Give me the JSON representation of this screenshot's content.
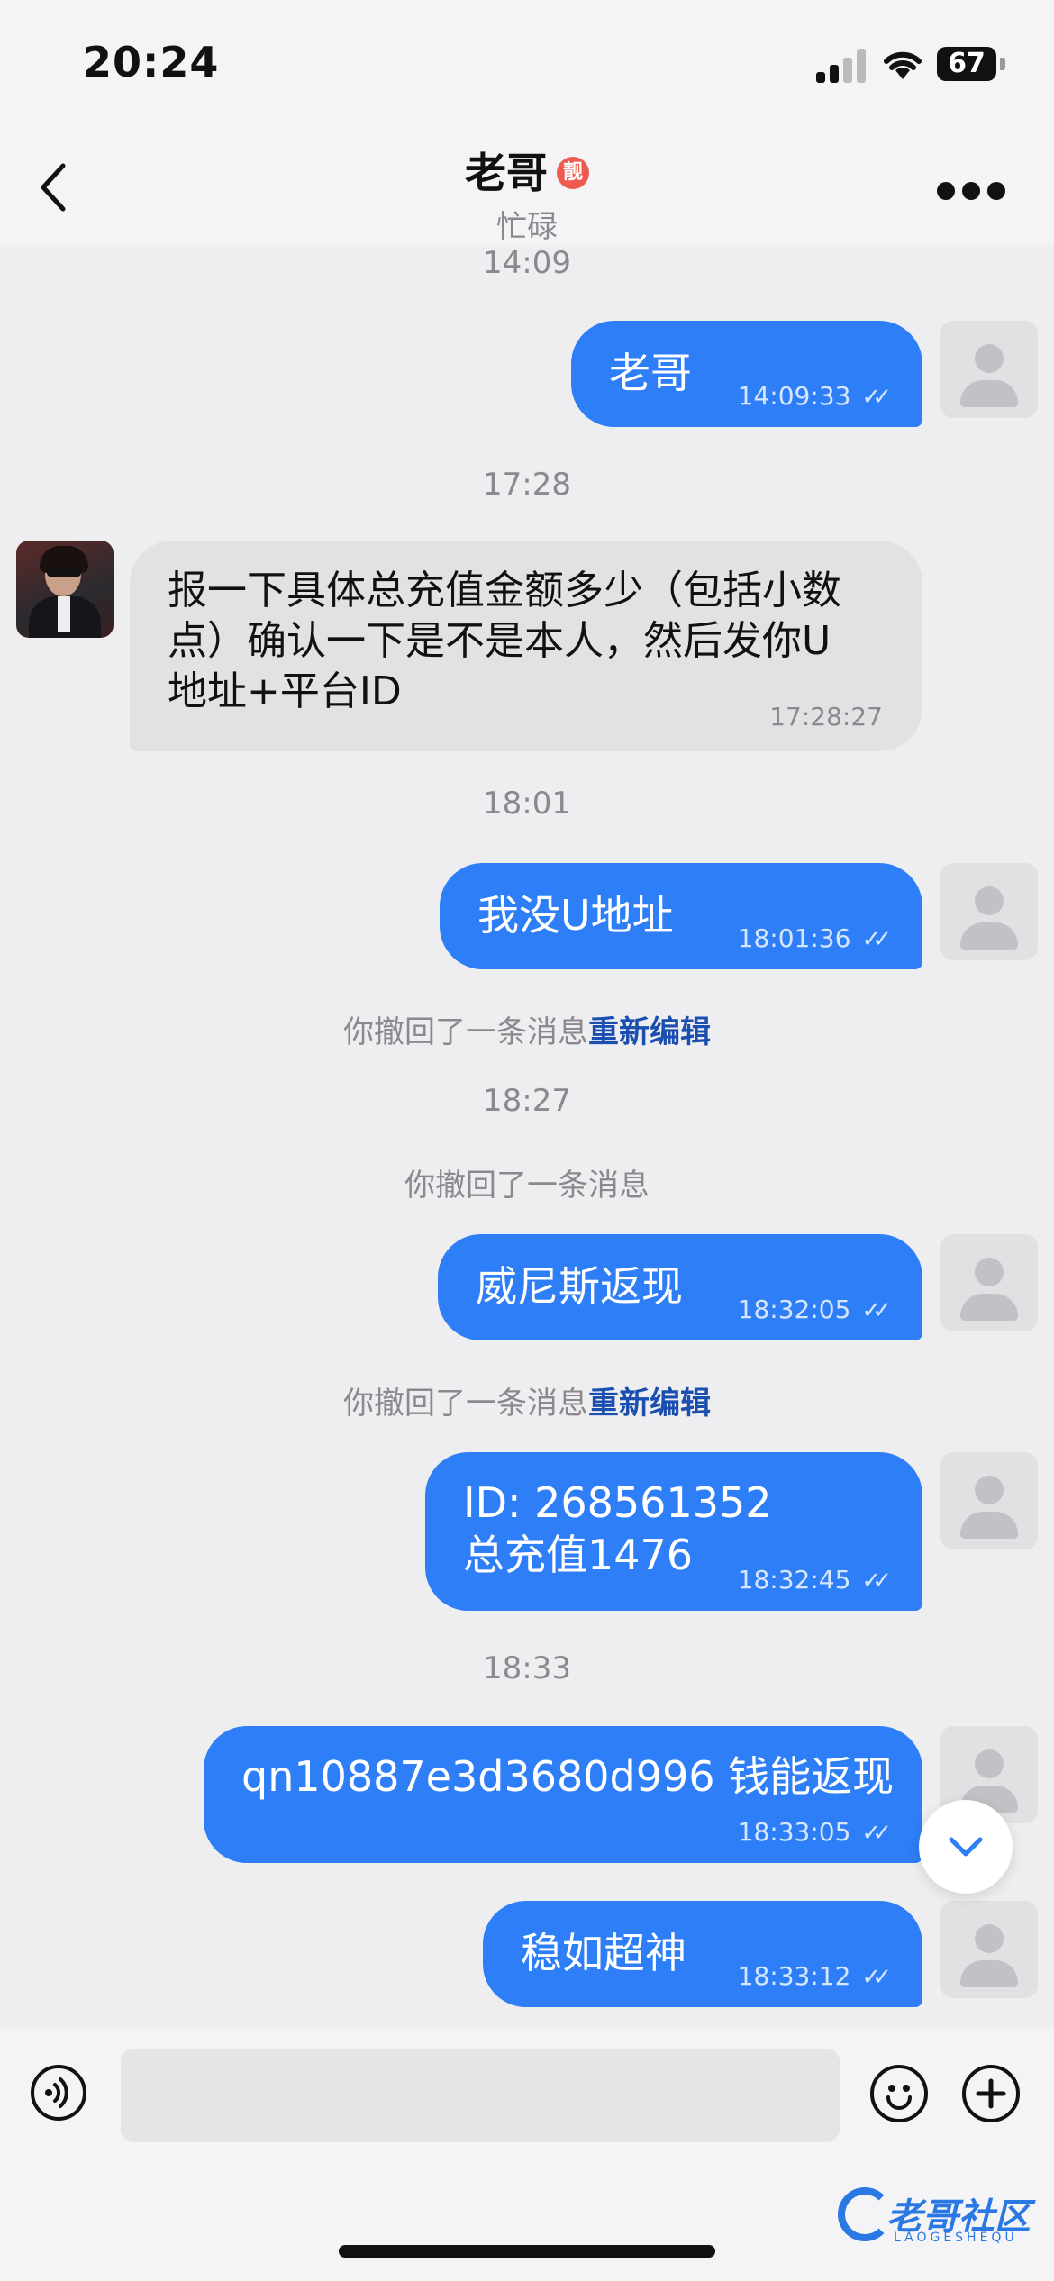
{
  "status_bar": {
    "time": "20:24",
    "battery": "67"
  },
  "header": {
    "title": "老哥",
    "badge": "靓",
    "subtitle": "忙碌"
  },
  "timestamps": {
    "t1": "14:09",
    "t2": "17:28",
    "t3": "18:01",
    "t4": "18:27",
    "t5": "18:33"
  },
  "messages": [
    {
      "text": "老哥",
      "time": "14:09:33"
    },
    {
      "text": "报一下具体总充值金额多少（包括小数点）确认一下是不是本人，然后发你U地址+平台ID",
      "time": "17:28:27"
    },
    {
      "text": "我没U地址",
      "time": "18:01:36"
    },
    {
      "text": "威尼斯返现",
      "time": "18:32:05"
    },
    {
      "line1": "ID: 268561352",
      "line2": "总充值1476",
      "time": "18:32:45"
    },
    {
      "text": "qn10887e3d3680d996 钱能返现",
      "time": "18:33:05"
    },
    {
      "text": "稳如超神",
      "time": "18:33:12"
    }
  ],
  "system": {
    "recalled": "你撤回了一条消息",
    "reedit": "重新编辑"
  },
  "input": {
    "placeholder": ""
  },
  "watermark": {
    "text": "老哥社区",
    "sub": "LAOGESHEQU"
  },
  "colors": {
    "outgoing_bubble": "#2d7ef7",
    "incoming_bubble": "#e2e2e4",
    "link": "#1a4fb0"
  }
}
